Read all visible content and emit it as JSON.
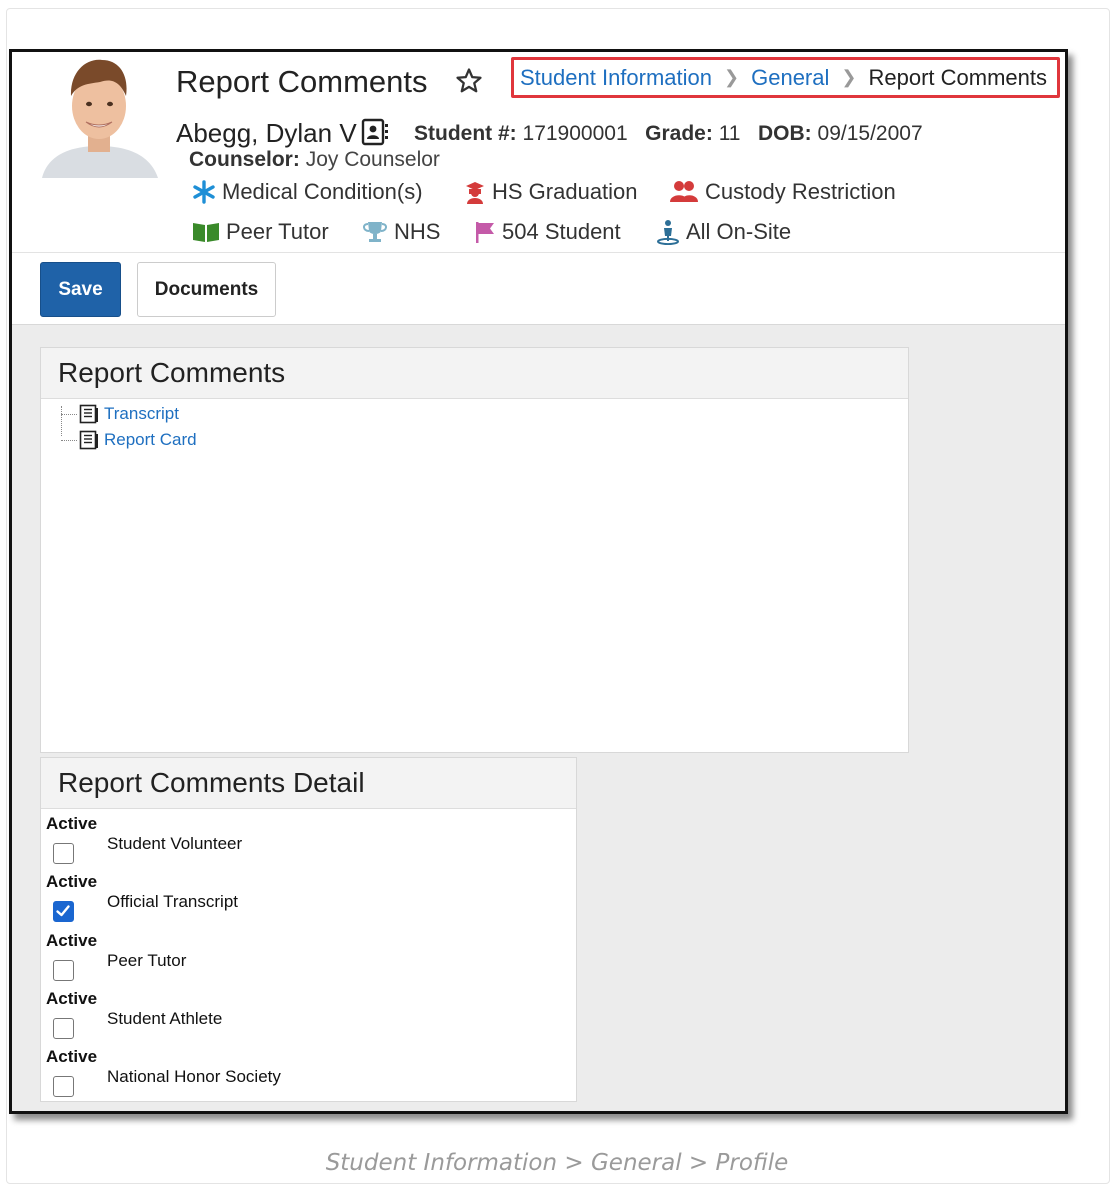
{
  "header": {
    "title": "Report Comments",
    "breadcrumb": [
      {
        "label": "Student Information",
        "link": true
      },
      {
        "label": "General",
        "link": true
      },
      {
        "label": "Report Comments",
        "link": false
      }
    ]
  },
  "student": {
    "name": "Abegg, Dylan V",
    "student_num_label": "Student #:",
    "student_num": "171900001",
    "grade_label": "Grade:",
    "grade": "11",
    "dob_label": "DOB:",
    "dob": "09/15/2007",
    "counselor_label": "Counselor:",
    "counselor": "Joy Counselor"
  },
  "flags": [
    {
      "label": "Medical Condition(s)",
      "icon": "asterisk-icon",
      "color": "#1e8fd6"
    },
    {
      "label": "HS Graduation",
      "icon": "graduation-cap-icon",
      "color": "#d43b3b"
    },
    {
      "label": "Custody Restriction",
      "icon": "users-icon",
      "color": "#d43b3b"
    },
    {
      "label": "Peer Tutor",
      "icon": "book-icon",
      "color": "#3a8a2a"
    },
    {
      "label": "NHS",
      "icon": "trophy-icon",
      "color": "#7fb3c9"
    },
    {
      "label": "504 Student",
      "icon": "flag-icon",
      "color": "#c45aa8"
    },
    {
      "label": "All On-Site",
      "icon": "person-location-icon",
      "color": "#2d6f97"
    }
  ],
  "toolbar": {
    "save_label": "Save",
    "documents_label": "Documents"
  },
  "tree_panel": {
    "title": "Report Comments",
    "items": [
      "Transcript",
      "Report Card"
    ]
  },
  "detail_panel": {
    "title": "Report Comments Detail",
    "active_label": "Active",
    "rows": [
      {
        "label": "Student Volunteer",
        "checked": false
      },
      {
        "label": "Official Transcript",
        "checked": true
      },
      {
        "label": "Peer Tutor",
        "checked": false
      },
      {
        "label": "Student Athlete",
        "checked": false
      },
      {
        "label": "National Honor Society",
        "checked": false
      }
    ]
  },
  "caption": "Student Information > General > Profile"
}
